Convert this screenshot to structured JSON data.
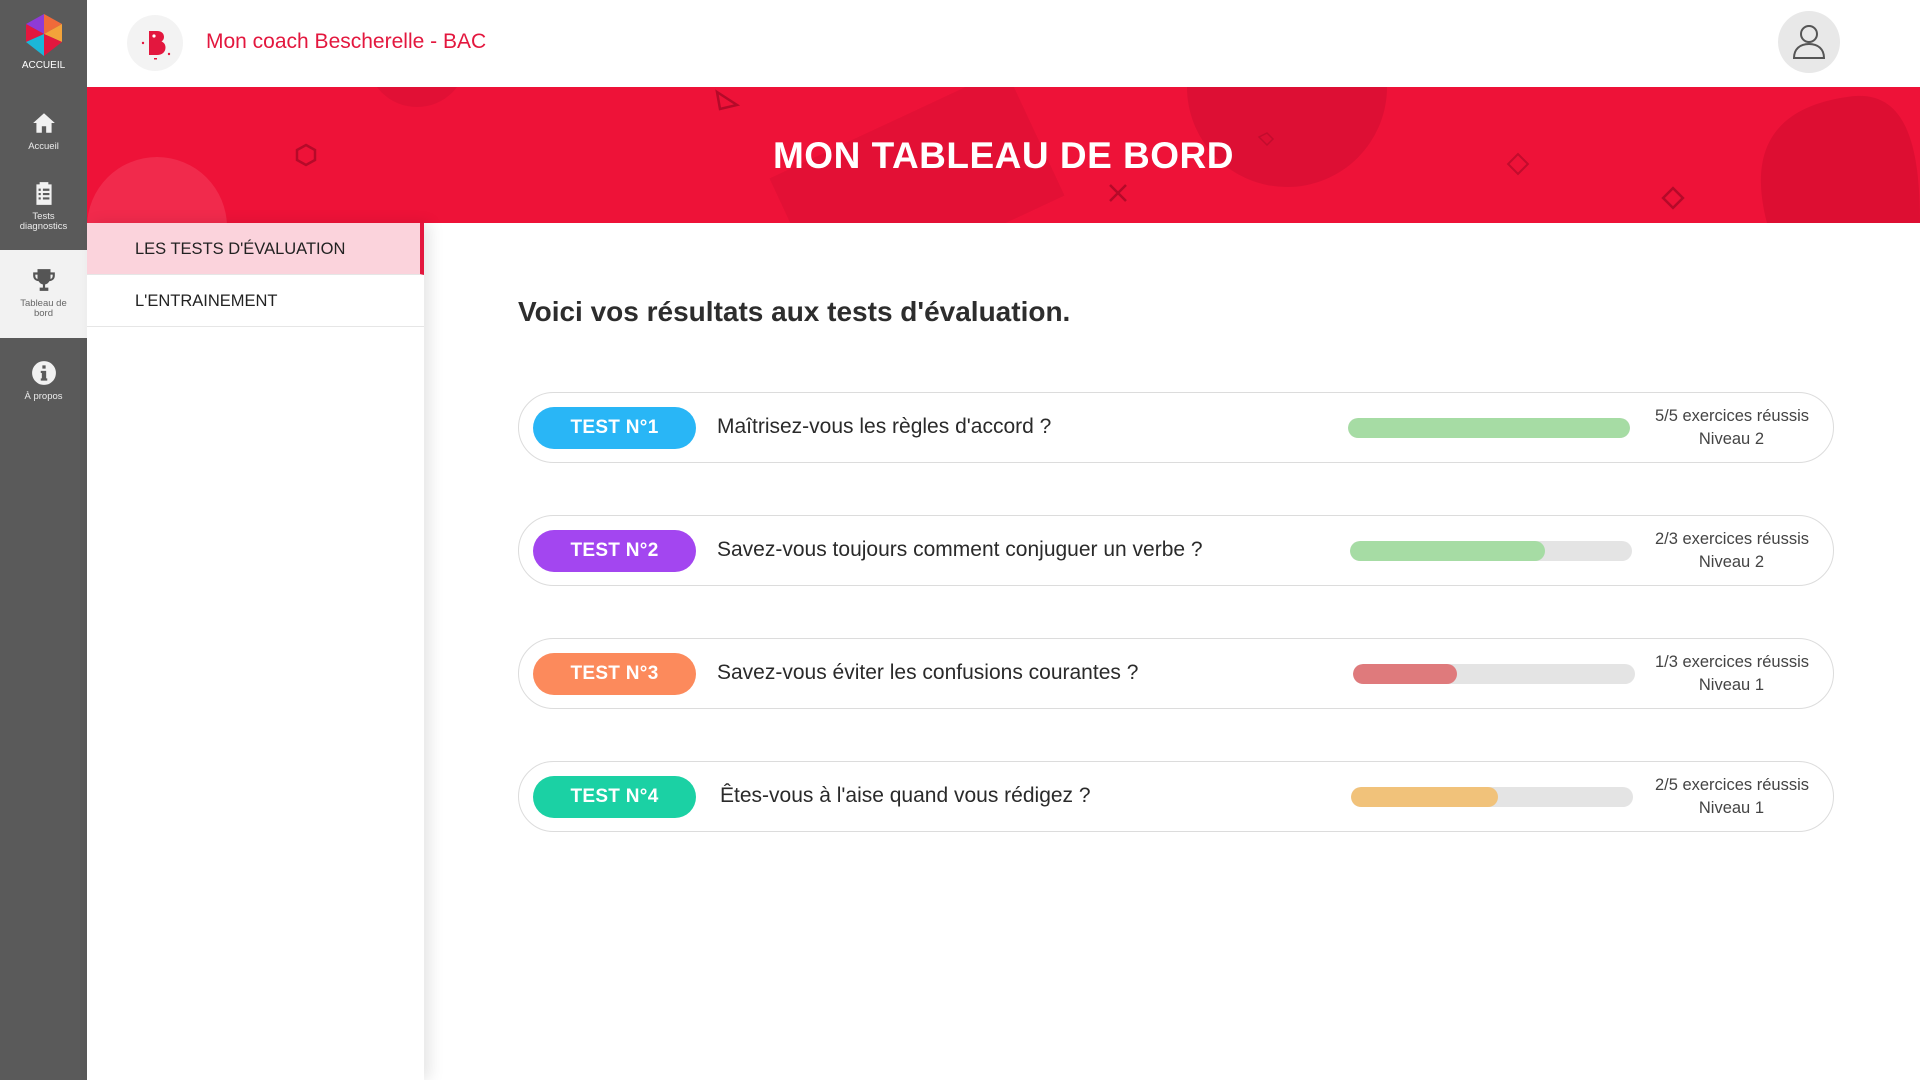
{
  "rail": {
    "logo_label": "ACCUEIL",
    "items": [
      {
        "label": "Accueil",
        "icon": "home-icon"
      },
      {
        "label": "Tests diagnostics",
        "icon": "clipboard-icon"
      },
      {
        "label": "Tableau de bord",
        "icon": "trophy-icon",
        "active": true
      },
      {
        "label": "À propos",
        "icon": "info-icon"
      }
    ]
  },
  "header": {
    "app_title": "Mon coach Bescherelle - BAC"
  },
  "banner": {
    "title": "MON TABLEAU DE BORD"
  },
  "submenu": {
    "items": [
      {
        "label": "LES TESTS D'ÉVALUATION",
        "active": true
      },
      {
        "label": "L'ENTRAINEMENT",
        "active": false
      }
    ]
  },
  "main": {
    "intro": "Voici vos résultats aux tests d'évaluation.",
    "tests": [
      {
        "badge": "TEST N°1",
        "question": "Maîtrisez-vous les règles d'accord ?",
        "score": "5/5 exercices réussis",
        "level": "Niveau 2",
        "progress": 1.0,
        "badge_color": "#29b6f6",
        "bar_color": "#a6dca4"
      },
      {
        "badge": "TEST N°2",
        "question": "Savez-vous toujours comment conjuguer un verbe ?",
        "score": "2/3 exercices réussis",
        "level": "Niveau 2",
        "progress": 0.69,
        "badge_color": "#a346f0",
        "bar_color": "#a6dca4"
      },
      {
        "badge": "TEST N°3",
        "question": "Savez-vous éviter les confusions courantes ?",
        "score": "1/3 exercices réussis",
        "level": "Niveau 1",
        "progress": 0.37,
        "badge_color": "#fc8a5c",
        "bar_color": "#df7a7c"
      },
      {
        "badge": "TEST N°4",
        "question": "Êtes-vous à l'aise quand vous rédigez ?",
        "score": "2/5 exercices réussis",
        "level": "Niveau 1",
        "progress": 0.52,
        "badge_color": "#1bd1a4",
        "bar_color": "#f1c27a"
      }
    ]
  },
  "colors": {
    "brand_red": "#ee1238",
    "rail_bg": "#5a5a5a",
    "submenu_active": "#fbd3dc"
  }
}
